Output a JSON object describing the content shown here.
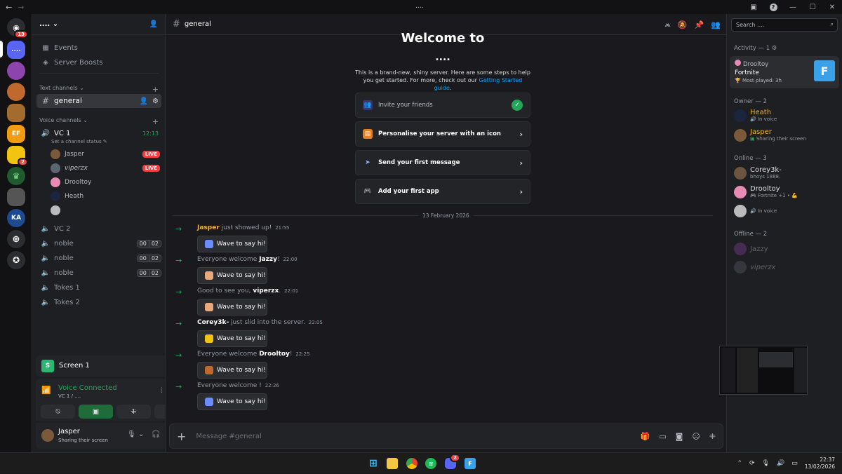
{
  "window": {
    "title": "...."
  },
  "guilds": [
    {
      "name": "discord-home",
      "badge": "13"
    },
    {
      "name": "current-server",
      "label": "...."
    },
    {
      "name": "server-3"
    },
    {
      "name": "server-4"
    },
    {
      "name": "server-5"
    },
    {
      "name": "server-ef",
      "label": "EF"
    },
    {
      "name": "server-7",
      "badge": "2"
    },
    {
      "name": "server-8"
    },
    {
      "name": "server-9"
    },
    {
      "name": "server-ka",
      "label": "KA"
    }
  ],
  "server": {
    "name": "....",
    "events_label": "Events",
    "boosts_label": "Server Boosts",
    "text_category": "Text channels",
    "voice_category": "Voice channels",
    "text_channels": [
      "general"
    ],
    "vc1": {
      "name": "VC 1",
      "timer": "12:13",
      "status": "Set a channel status"
    },
    "vc1_users": [
      {
        "name": "Jasper",
        "live": "LIVE"
      },
      {
        "name": "viperzx",
        "live": "LIVE"
      },
      {
        "name": "Drooltoy"
      },
      {
        "name": "Heath"
      },
      {
        "name": ""
      }
    ],
    "voice_channels": [
      {
        "name": "VC 2"
      },
      {
        "name": "noble",
        "count_a": "00",
        "count_b": "02"
      },
      {
        "name": "noble",
        "count_a": "00",
        "count_b": "02"
      },
      {
        "name": "noble",
        "count_a": "00",
        "count_b": "02"
      },
      {
        "name": "Tokes 1"
      },
      {
        "name": "Tokes 2"
      }
    ]
  },
  "stream_panel": {
    "title": "Screen 1"
  },
  "voice_panel": {
    "status": "Voice Connected",
    "channel": "VC 1 / ...."
  },
  "user_panel": {
    "name": "Jasper",
    "status": "Sharing their screen"
  },
  "channel": {
    "name": "general"
  },
  "welcome": {
    "title": "Welcome to",
    "server": "....",
    "subtitle": "This is a brand-new, shiny server. Here are some steps to help you get started. For more, check out our",
    "link": "Getting Started guide",
    "steps": [
      "Invite your friends",
      "Personalise your server with an icon",
      "Send your first message",
      "Add your first app"
    ]
  },
  "date_divider": "13 February 2026",
  "messages": [
    {
      "pre": "",
      "name": "Jasper",
      "post": " just showed up!",
      "time": "21:55",
      "name_color": "#f0b232"
    },
    {
      "pre": "Everyone welcome ",
      "name": "Jazzy",
      "post": "!",
      "time": "22:00",
      "name_color": "#ffffff"
    },
    {
      "pre": "Good to see you, ",
      "name": "viperzx",
      "post": ".",
      "time": "22:01",
      "name_color": "#ffffff"
    },
    {
      "pre": "",
      "name": "Corey3k-",
      "post": " just slid into the server.",
      "time": "22:05",
      "name_color": "#ffffff"
    },
    {
      "pre": "Everyone welcome ",
      "name": "Drooltoy",
      "post": "!",
      "time": "22:25",
      "name_color": "#ffffff"
    },
    {
      "pre": "Everyone welcome ",
      "name": "",
      "post": " !",
      "time": "22:26",
      "name_color": "#ffffff"
    }
  ],
  "wave_label": "Wave to say hi!",
  "composer": {
    "placeholder": "Message #general"
  },
  "members": {
    "search_placeholder": "Search ....",
    "activity_header": "Activity — 1",
    "activity": {
      "user": "Drooltoy",
      "game": "Fortnite",
      "detail": "Most played: 3h"
    },
    "owner_header": "Owner — 2",
    "owners": [
      {
        "name": "Heath",
        "status": "In voice",
        "color": "#f0b232"
      },
      {
        "name": "Jasper",
        "status": "Sharing their screen",
        "color": "#f0b232"
      }
    ],
    "online_header": "Online — 3",
    "online": [
      {
        "name": "Corey3k-",
        "status": "bhoys 1888."
      },
      {
        "name": "Drooltoy",
        "status": "Fortnite +1 •"
      },
      {
        "name": "",
        "status": "In voice"
      }
    ],
    "offline_header": "Offline — 2",
    "offline": [
      {
        "name": "Jazzy"
      },
      {
        "name": "viperzx"
      }
    ]
  },
  "taskbar": {
    "time": "22:37",
    "date": "13/02/2026",
    "discord_badge": "2"
  }
}
